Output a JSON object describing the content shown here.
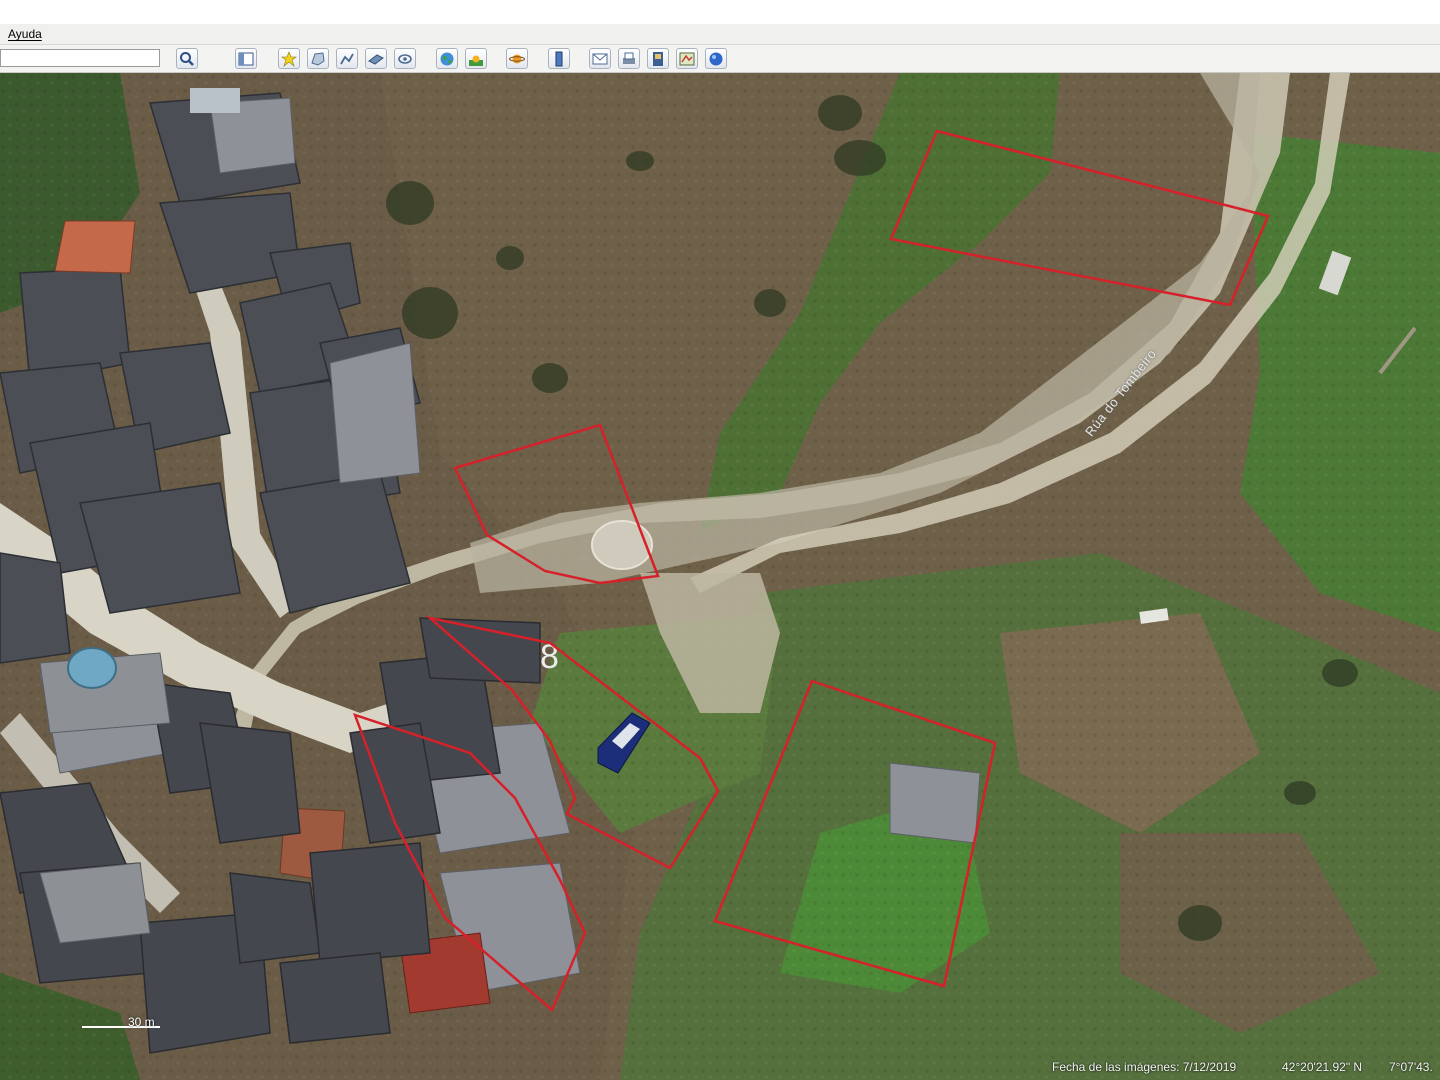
{
  "menu": {
    "help_label": "Ayuda"
  },
  "toolbar": {
    "search_value": "",
    "buttons": [
      "search-icon",
      "sidebar-icon",
      "placemark-icon",
      "polygon-icon",
      "path-icon",
      "overlay-icon",
      "tour-icon",
      "earth-icon",
      "sun-icon",
      "planets-icon",
      "ruler-icon",
      "email-icon",
      "print-icon",
      "save-image-icon",
      "maps-icon",
      "globe-icon"
    ]
  },
  "map": {
    "road_label": "Rúa do Tombeiro",
    "scale_label": "30 m",
    "parcel_outline_color": "#d6202a",
    "parcels_count": 5
  },
  "status": {
    "imagery_date": "Fecha de las imágenes: 7/12/2019",
    "latitude": "42°20'21.92\" N",
    "longitude": "7°07'43."
  }
}
